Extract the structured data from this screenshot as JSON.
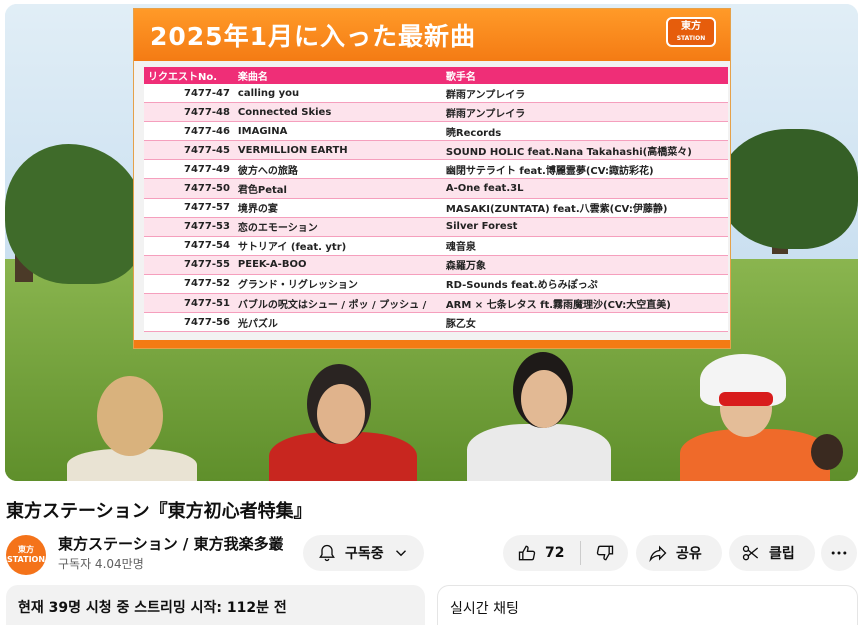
{
  "board": {
    "title": "2025年1月に入った最新曲",
    "logo_top": "東方",
    "logo_bottom": "STATION",
    "headers": [
      "リクエストNo.",
      "楽曲名",
      "歌手名"
    ],
    "rows": [
      [
        "7477-47",
        "calling you",
        "群雨アンプレイラ"
      ],
      [
        "7477-48",
        "Connected Skies",
        "群雨アンプレイラ"
      ],
      [
        "7477-46",
        "IMAGINA",
        "暁Records"
      ],
      [
        "7477-45",
        "VERMILLION EARTH",
        "SOUND HOLIC feat.Nana Takahashi(高橋菜々)"
      ],
      [
        "7477-49",
        "彼方への旅路",
        "幽閉サテライト feat.博麗霊夢(CV:諏訪彩花)"
      ],
      [
        "7477-50",
        "君色Petal",
        "A-One feat.3L"
      ],
      [
        "7477-57",
        "境界の宴",
        "MASAKI(ZUNTATA) feat.八雲紫(CV:伊藤静)"
      ],
      [
        "7477-53",
        "恋のエモーション",
        "Silver Forest"
      ],
      [
        "7477-54",
        "サトリアイ (feat. ytr)",
        "魂音泉"
      ],
      [
        "7477-55",
        "PEEK-A-BOO",
        "森羅万象"
      ],
      [
        "7477-52",
        "グランド・リグレッション",
        "RD-Sounds feat.めらみぽっぷ"
      ],
      [
        "7477-51",
        "バブルの呪文はシュー / ポッ / プッシュ /",
        "ARM × 七条レタス ft.霧雨魔理沙(CV:大空直美)"
      ],
      [
        "7477-56",
        "光パズル",
        "豚乙女"
      ]
    ]
  },
  "video": {
    "title": "東方ステーション『東方初心者特集』"
  },
  "channel": {
    "avatar_line1": "東方",
    "avatar_line2": "STATION",
    "name": "東方ステーション / 東方我楽多叢誌",
    "subs": "구독자 4.04만명"
  },
  "actions": {
    "subscribe": "구독중",
    "likes": "72",
    "share": "공유",
    "clip": "클립"
  },
  "info": {
    "text": "현재 39명 시청 중 스트리밍 시작: 112분 전"
  },
  "chat": {
    "title": "실시간 채팅"
  }
}
